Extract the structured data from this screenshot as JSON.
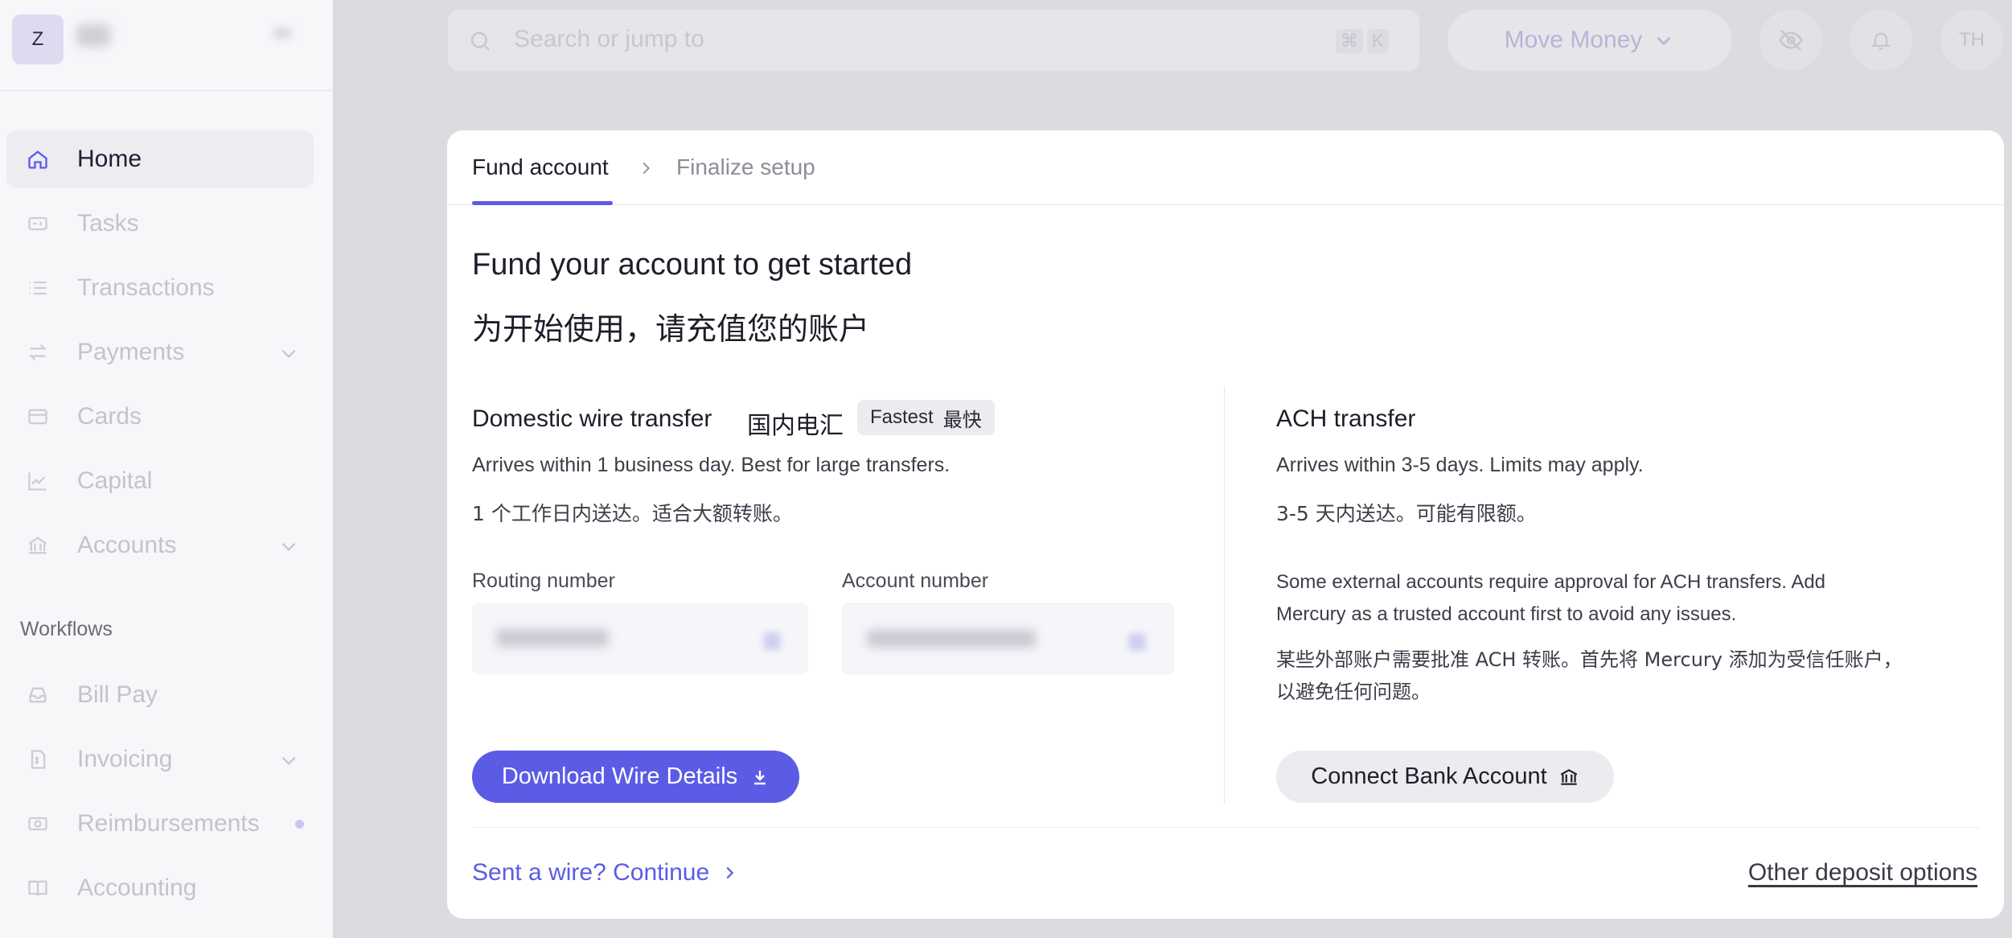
{
  "sidebar": {
    "workspace_initial": "Z",
    "items": [
      {
        "label": "Home",
        "icon": "home-icon",
        "active": true
      },
      {
        "label": "Tasks",
        "icon": "tasks-icon"
      },
      {
        "label": "Transactions",
        "icon": "list-icon"
      },
      {
        "label": "Payments",
        "icon": "arrows-icon",
        "expandable": true
      },
      {
        "label": "Cards",
        "icon": "card-icon"
      },
      {
        "label": "Capital",
        "icon": "chart-icon"
      },
      {
        "label": "Accounts",
        "icon": "bank-icon",
        "expandable": true
      }
    ],
    "workflows_label": "Workflows",
    "workflow_items": [
      {
        "label": "Bill Pay",
        "icon": "inbox-icon"
      },
      {
        "label": "Invoicing",
        "icon": "invoice-icon",
        "expandable": true
      },
      {
        "label": "Reimbursements",
        "icon": "cash-icon",
        "has_dot": true
      },
      {
        "label": "Accounting",
        "icon": "book-icon"
      }
    ]
  },
  "topbar": {
    "search_placeholder": "Search or jump to",
    "shortcut_cmd": "⌘",
    "shortcut_key": "K",
    "move_money_label": "Move Money",
    "user_initials": "TH"
  },
  "card": {
    "tabs": [
      {
        "label": "Fund account",
        "active": true
      },
      {
        "label": "Finalize setup",
        "active": false
      }
    ],
    "heading_en": "Fund your account to get started",
    "heading_zh": "为开始使用，请充值您的账户",
    "wire": {
      "title_en": "Domestic wire transfer",
      "title_zh": "国内电汇",
      "badge_en": "Fastest",
      "badge_zh": "最快",
      "desc_en": "Arrives within 1 business day. Best for large transfers.",
      "desc_zh": "1 个工作日内送达。适合大额转账。",
      "routing_label": "Routing number",
      "account_label": "Account number",
      "download_button": "Download Wire Details"
    },
    "ach": {
      "title": "ACH transfer",
      "desc_en": "Arrives within 3-5 days. Limits may apply.",
      "desc_zh": "3-5 天内送达。可能有限额。",
      "note_en_1": "Some external accounts require approval for ACH transfers. Add",
      "note_en_2": "Mercury as a trusted account first to avoid any issues.",
      "note_zh_1": "某些外部账户需要批准 ACH 转账。首先将 Mercury 添加为受信任账户，",
      "note_zh_2": "以避免任何问题。",
      "connect_button": "Connect Bank Account"
    },
    "continue_link": "Sent a wire? Continue",
    "other_link": "Other deposit options"
  },
  "colors": {
    "accent": "#5b5be6",
    "dim_background": "#dcdce0",
    "card_background": "#ffffff"
  }
}
